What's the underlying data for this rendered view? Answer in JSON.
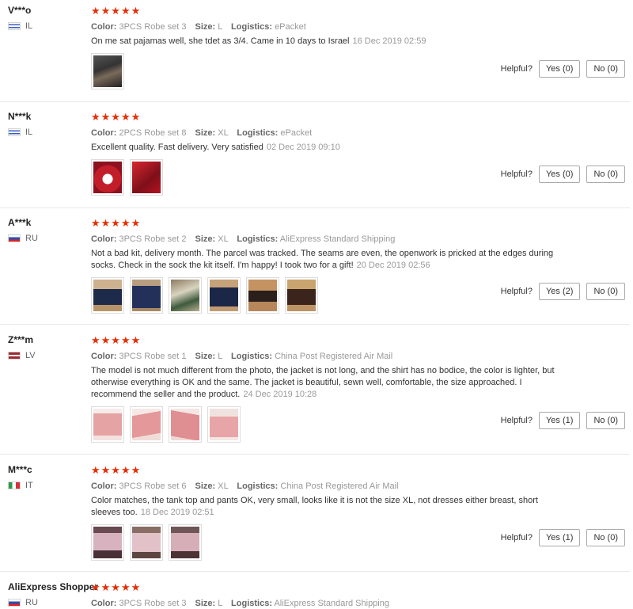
{
  "helpful_label": "Helpful?",
  "colors": {
    "star": "#e62e04",
    "muted": "#999999",
    "text": "#333333"
  },
  "reviews": [
    {
      "buyer": "V***o",
      "country": "IL",
      "stars": "★★★★★",
      "color_label": "Color:",
      "color": "3PCS Robe set 3",
      "size_label": "Size:",
      "size": "L",
      "logistics_label": "Logistics:",
      "logistics": "ePacket",
      "text": "On me sat pajamas well, she tdet as 3/4. Came in 10 days to Israel",
      "date": "16 Dec 2019 02:59",
      "yes": "Yes (0)",
      "no": "No (0)"
    },
    {
      "buyer": "N***k",
      "country": "IL",
      "stars": "★★★★★",
      "color_label": "Color:",
      "color": "2PCS Robe set 8",
      "size_label": "Size:",
      "size": "XL",
      "logistics_label": "Logistics:",
      "logistics": "ePacket",
      "text": "Excellent quality. Fast delivery. Very satisfied",
      "date": "02 Dec 2019 09:10",
      "yes": "Yes (0)",
      "no": "No (0)"
    },
    {
      "buyer": "A***k",
      "country": "RU",
      "stars": "★★★★★",
      "color_label": "Color:",
      "color": "3PCS Robe set 2",
      "size_label": "Size:",
      "size": "XL",
      "logistics_label": "Logistics:",
      "logistics": "AliExpress Standard Shipping",
      "text": "Not a bad kit, delivery month. The parcel was tracked. The seams are even, the openwork is pricked at the edges during socks. Check in the sock the kit itself. I'm happy! I took two for a gift!",
      "date": "20 Dec 2019 02:56",
      "yes": "Yes (2)",
      "no": "No (0)"
    },
    {
      "buyer": "Z***m",
      "country": "LV",
      "stars": "★★★★★",
      "color_label": "Color:",
      "color": "3PCS Robe set 1",
      "size_label": "Size:",
      "size": "L",
      "logistics_label": "Logistics:",
      "logistics": "China Post Registered Air Mail",
      "text": "The model is not much different from the photo, the jacket is not long, and the shirt has no bodice, the color is lighter, but otherwise everything is OK and the same. The jacket is beautiful, sewn well, comfortable, the size approached. I recommend the seller and the product.",
      "date": "24 Dec 2019 10:28",
      "yes": "Yes (1)",
      "no": "No (0)"
    },
    {
      "buyer": "M***c",
      "country": "IT",
      "stars": "★★★★★",
      "color_label": "Color:",
      "color": "3PCS Robe set 6",
      "size_label": "Size:",
      "size": "XL",
      "logistics_label": "Logistics:",
      "logistics": "China Post Registered Air Mail",
      "text": "Color matches, the tank top and pants OK, very small, looks like it is not the size XL, not dresses either breast, short sleeves too.",
      "date": "18 Dec 2019 02:51",
      "yes": "Yes (1)",
      "no": "No (0)"
    },
    {
      "buyer": "AliExpress Shopper",
      "country": "RU",
      "stars": "★★★★★",
      "color_label": "Color:",
      "color": "3PCS Robe set 3",
      "size_label": "Size:",
      "size": "L",
      "logistics_label": "Logistics:",
      "logistics": "AliExpress Standard Shipping"
    }
  ]
}
